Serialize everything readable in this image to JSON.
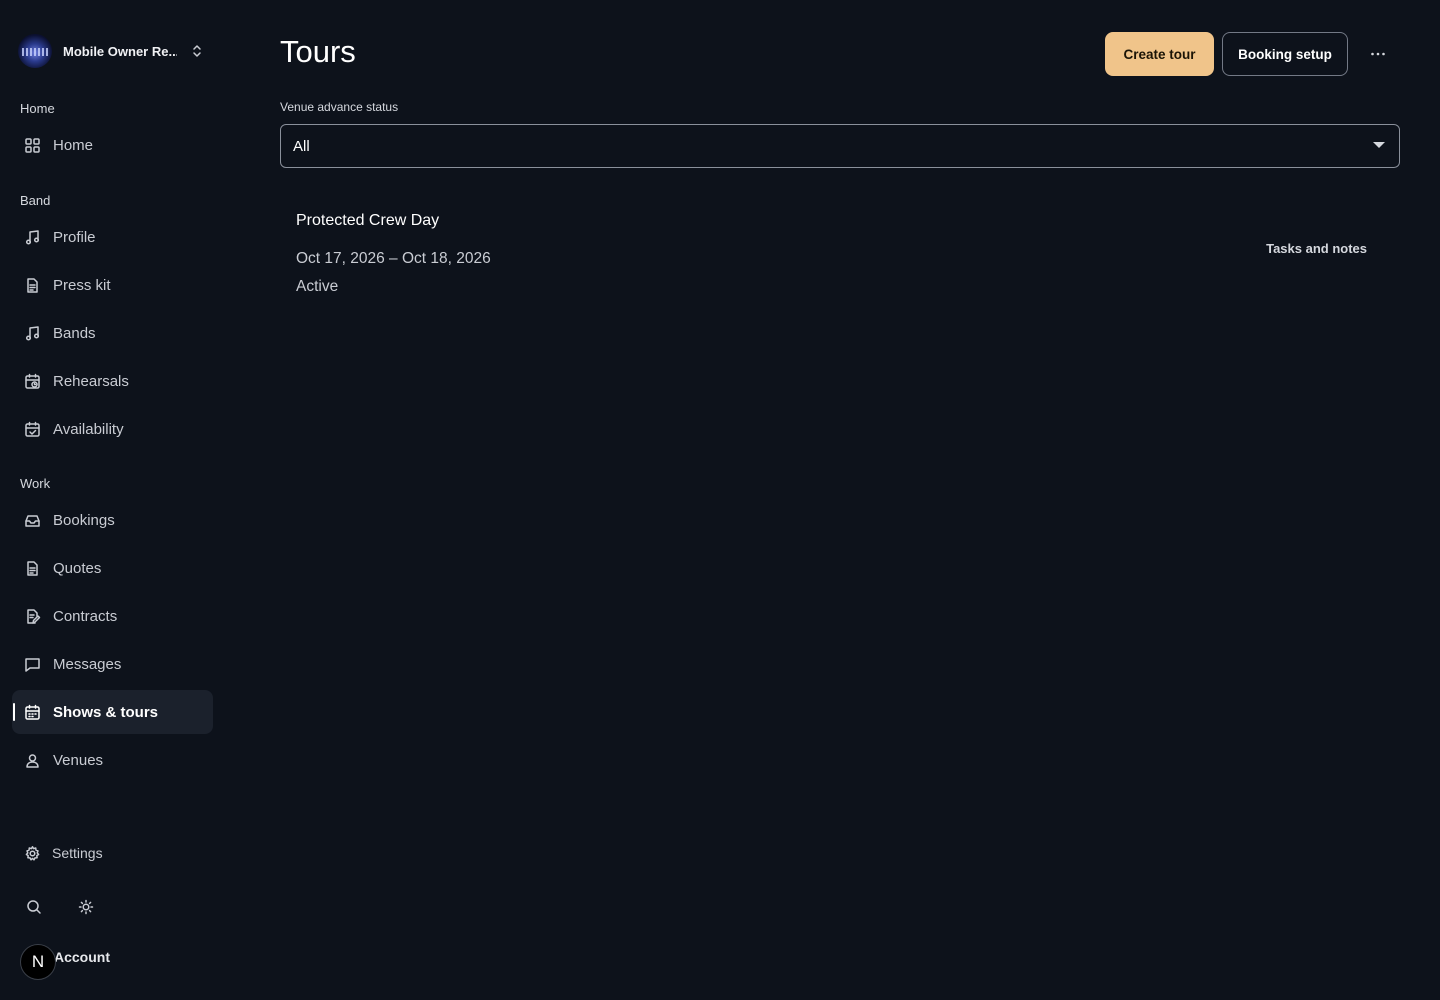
{
  "sidebar": {
    "workspace_name": "Mobile Owner Re...",
    "sections": {
      "home": "Home",
      "band": "Band",
      "work": "Work"
    },
    "items": {
      "home": {
        "label": "Home",
        "icon": "grid-icon"
      },
      "profile": {
        "label": "Profile",
        "icon": "music-note-icon"
      },
      "press_kit": {
        "label": "Press kit",
        "icon": "document-icon"
      },
      "bands": {
        "label": "Bands",
        "icon": "music-note-icon"
      },
      "rehearsals": {
        "label": "Rehearsals",
        "icon": "calendar-clock-icon"
      },
      "availability": {
        "label": "Availability",
        "icon": "calendar-check-icon"
      },
      "bookings": {
        "label": "Bookings",
        "icon": "inbox-icon"
      },
      "quotes": {
        "label": "Quotes",
        "icon": "document-icon"
      },
      "contracts": {
        "label": "Contracts",
        "icon": "document-edit-icon"
      },
      "messages": {
        "label": "Messages",
        "icon": "chat-icon"
      },
      "shows_tours": {
        "label": "Shows & tours",
        "icon": "calendar-icon"
      },
      "venues": {
        "label": "Venues",
        "icon": "location-person-icon"
      }
    },
    "settings_label": "Settings",
    "account_label": "Account",
    "avatar_initial": "N"
  },
  "header": {
    "title": "Tours",
    "create_tour_label": "Create tour",
    "booking_setup_label": "Booking setup"
  },
  "filter": {
    "label": "Venue advance status",
    "selected": "All"
  },
  "tours": [
    {
      "name": "Protected Crew Day",
      "dates": "Oct 17, 2026 – Oct 18, 2026",
      "status": "Active",
      "link_label": "Tasks and notes"
    }
  ],
  "colors": {
    "background": "#0d121b",
    "accent": "#f0c48a",
    "active_nav_bg": "#1b212c"
  }
}
